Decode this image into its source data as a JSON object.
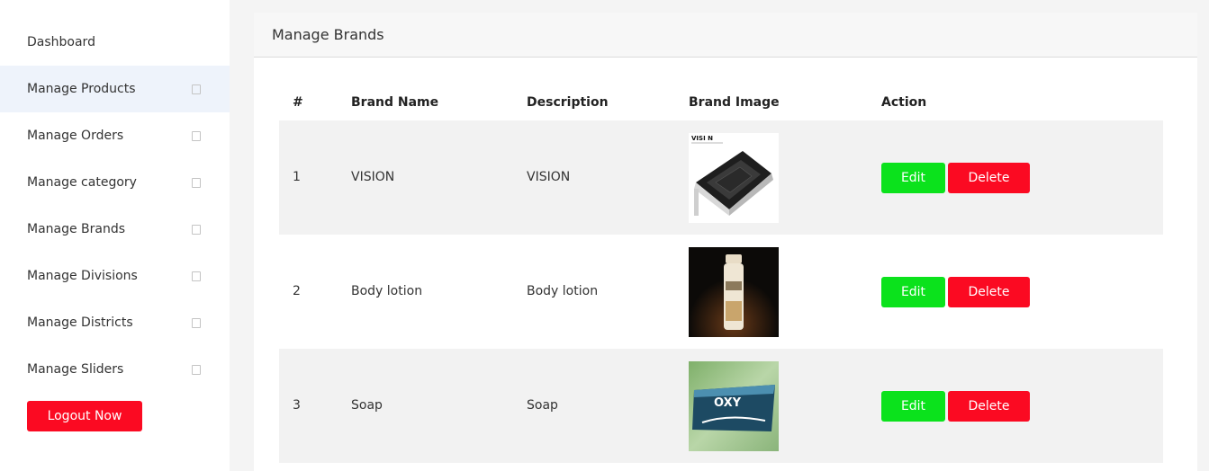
{
  "sidebar": {
    "items": [
      {
        "label": "Dashboard",
        "has_chevron": false
      },
      {
        "label": "Manage Products",
        "has_chevron": true
      },
      {
        "label": "Manage Orders",
        "has_chevron": true
      },
      {
        "label": "Manage category",
        "has_chevron": true
      },
      {
        "label": "Manage Brands",
        "has_chevron": true
      },
      {
        "label": "Manage Divisions",
        "has_chevron": true
      },
      {
        "label": "Manage Districts",
        "has_chevron": true
      },
      {
        "label": "Manage Sliders",
        "has_chevron": true
      }
    ],
    "logout_label": "Logout Now"
  },
  "page": {
    "title": "Manage Brands"
  },
  "table": {
    "headers": {
      "num": "#",
      "name": "Brand Name",
      "desc": "Description",
      "image": "Brand Image",
      "action": "Action"
    },
    "rows": [
      {
        "num": "1",
        "name": "VISION",
        "desc": "VISION",
        "image_logo": "VISI N"
      },
      {
        "num": "2",
        "name": "Body lotion",
        "desc": "Body lotion"
      },
      {
        "num": "3",
        "name": "Soap",
        "desc": "Soap",
        "image_logo": "OXY"
      }
    ],
    "edit_label": "Edit",
    "delete_label": "Delete"
  },
  "colors": {
    "edit": "#0be21c",
    "delete": "#fb0a22",
    "active_nav": "#eef3fb"
  }
}
